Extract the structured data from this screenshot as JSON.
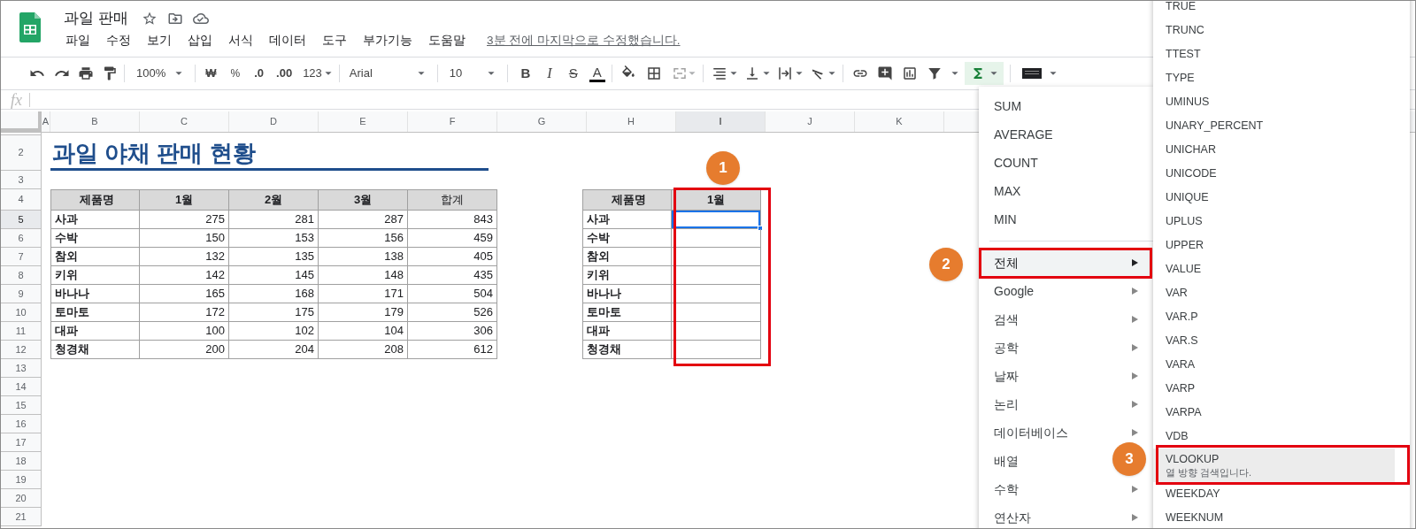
{
  "document": {
    "title": "과일 판매"
  },
  "menu_bar": {
    "items": [
      "파일",
      "수정",
      "보기",
      "삽입",
      "서식",
      "데이터",
      "도구",
      "부가기능",
      "도움말"
    ],
    "last_edit": "3분 전에 마지막으로 수정했습니다."
  },
  "toolbar": {
    "zoom": "100%",
    "currency": "₩",
    "percent": "%",
    "decimal_decrease": ".0",
    "decimal_increase": ".00",
    "number_format": "123",
    "font": "Arial",
    "font_size": "10",
    "format_buttons": [
      "B",
      "I",
      "S",
      "A"
    ],
    "functions_expanded": true
  },
  "formula_bar": {
    "label": "fx"
  },
  "sheet": {
    "columns": [
      {
        "label": "A",
        "selected": false
      },
      {
        "label": "B",
        "selected": false
      },
      {
        "label": "C",
        "selected": false
      },
      {
        "label": "D",
        "selected": false
      },
      {
        "label": "E",
        "selected": false
      },
      {
        "label": "F",
        "selected": false
      },
      {
        "label": "G",
        "selected": false
      },
      {
        "label": "H",
        "selected": false
      },
      {
        "label": "I",
        "selected": true
      },
      {
        "label": "J",
        "selected": false
      },
      {
        "label": "K",
        "selected": false
      }
    ],
    "row_numbers": [
      {
        "label": "2",
        "selected": false
      },
      {
        "label": "3",
        "selected": false
      },
      {
        "label": "4",
        "selected": false
      },
      {
        "label": "5",
        "selected": true
      },
      {
        "label": "6",
        "selected": false
      },
      {
        "label": "7",
        "selected": false
      },
      {
        "label": "8",
        "selected": false
      },
      {
        "label": "9",
        "selected": false
      },
      {
        "label": "10",
        "selected": false
      },
      {
        "label": "11",
        "selected": false
      },
      {
        "label": "12",
        "selected": false
      },
      {
        "label": "13",
        "selected": false
      },
      {
        "label": "14",
        "selected": false
      },
      {
        "label": "15",
        "selected": false
      },
      {
        "label": "16",
        "selected": false
      },
      {
        "label": "17",
        "selected": false
      },
      {
        "label": "18",
        "selected": false
      },
      {
        "label": "19",
        "selected": false
      },
      {
        "label": "20",
        "selected": false
      },
      {
        "label": "21",
        "selected": false
      }
    ],
    "title": "과일 야채 판매 현황",
    "sales_table": {
      "columns": [
        "제품명",
        "1월",
        "2월",
        "3월",
        "합계"
      ],
      "rows": [
        {
          "product": "사과",
          "values": [
            "275",
            "281",
            "287",
            "843"
          ]
        },
        {
          "product": "수박",
          "values": [
            "150",
            "153",
            "156",
            "459"
          ]
        },
        {
          "product": "참외",
          "values": [
            "132",
            "135",
            "138",
            "405"
          ]
        },
        {
          "product": "키위",
          "values": [
            "142",
            "145",
            "148",
            "435"
          ]
        },
        {
          "product": "바나나",
          "values": [
            "165",
            "168",
            "171",
            "504"
          ]
        },
        {
          "product": "토마토",
          "values": [
            "172",
            "175",
            "179",
            "526"
          ]
        },
        {
          "product": "대파",
          "values": [
            "100",
            "102",
            "104",
            "306"
          ]
        },
        {
          "product": "청경채",
          "values": [
            "200",
            "204",
            "208",
            "612"
          ]
        }
      ]
    },
    "lookup_table": {
      "columns": [
        "제품명",
        "1월"
      ],
      "rows": [
        {
          "product": "사과",
          "selected": true
        },
        {
          "product": "수박",
          "selected": false
        },
        {
          "product": "참외",
          "selected": false
        },
        {
          "product": "키위",
          "selected": false
        },
        {
          "product": "바나나",
          "selected": false
        },
        {
          "product": "토마토",
          "selected": false
        },
        {
          "product": "대파",
          "selected": false
        },
        {
          "product": "청경채",
          "selected": false
        }
      ]
    }
  },
  "function_menu": {
    "quick_functions": [
      "SUM",
      "AVERAGE",
      "COUNT",
      "MAX",
      "MIN"
    ],
    "categories": [
      {
        "label": "전체",
        "selected": true
      },
      {
        "label": "Google",
        "selected": false
      },
      {
        "label": "검색",
        "selected": false
      },
      {
        "label": "공학",
        "selected": false
      },
      {
        "label": "날짜",
        "selected": false
      },
      {
        "label": "논리",
        "selected": false
      },
      {
        "label": "데이터베이스",
        "selected": false
      },
      {
        "label": "배열",
        "selected": false
      },
      {
        "label": "수학",
        "selected": false
      },
      {
        "label": "연산자",
        "selected": false
      }
    ]
  },
  "function_list": [
    {
      "name": "TRUE",
      "selected": false
    },
    {
      "name": "TRUNC",
      "selected": false
    },
    {
      "name": "TTEST",
      "selected": false
    },
    {
      "name": "TYPE",
      "selected": false
    },
    {
      "name": "UMINUS",
      "selected": false
    },
    {
      "name": "UNARY_PERCENT",
      "selected": false
    },
    {
      "name": "UNICHAR",
      "selected": false
    },
    {
      "name": "UNICODE",
      "selected": false
    },
    {
      "name": "UNIQUE",
      "selected": false
    },
    {
      "name": "UPLUS",
      "selected": false
    },
    {
      "name": "UPPER",
      "selected": false
    },
    {
      "name": "VALUE",
      "selected": false
    },
    {
      "name": "VAR",
      "selected": false
    },
    {
      "name": "VAR.P",
      "selected": false
    },
    {
      "name": "VAR.S",
      "selected": false
    },
    {
      "name": "VARA",
      "selected": false
    },
    {
      "name": "VARP",
      "selected": false
    },
    {
      "name": "VARPA",
      "selected": false
    },
    {
      "name": "VDB",
      "selected": false
    },
    {
      "name": "VLOOKUP",
      "description": "열 방향 검색입니다.",
      "selected": true
    },
    {
      "name": "WEEKDAY",
      "selected": false
    },
    {
      "name": "WEEKNUM",
      "selected": false
    }
  ],
  "callouts": [
    {
      "label": "1"
    },
    {
      "label": "2"
    },
    {
      "label": "3"
    }
  ]
}
